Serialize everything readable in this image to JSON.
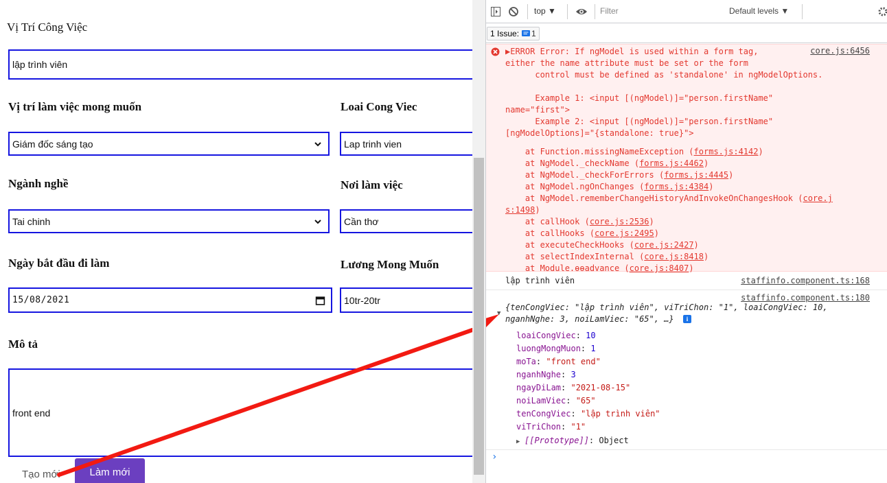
{
  "form": {
    "job_title_label": "Vị Trí Công Việc",
    "job_title_value": "lập trình viên",
    "desired_position_label": "Vị trí làm việc mong muốn",
    "desired_position_value": "Giám đốc sáng tạo",
    "job_type_label": "Loai Cong Viec",
    "job_type_value": "Lap trinh vien",
    "industry_label": "Ngành nghề",
    "industry_value": "Tai chinh",
    "workplace_label": "Nơi làm việc",
    "workplace_value": "Cần thơ",
    "start_date_label": "Ngày bắt đầu đi làm",
    "start_date_value": "15/08/2021",
    "salary_label": "Lương Mong Muốn",
    "salary_value": "10tr-20tr",
    "description_label": "Mô tả",
    "description_value": "front end",
    "create_button": "Tạo mới",
    "reset_button": "Làm mới",
    "primary_color": "#6b3fc0",
    "field_border_color": "#1515e0"
  },
  "devtools": {
    "context": "top ▼",
    "filter_placeholder": "Filter",
    "levels": "Default levels ▼",
    "issues_label": "1 Issue:",
    "issues_count": "1",
    "error_lines": [
      "▶ERROR Error: If ngModel is used within a form tag,",
      "either the name attribute must be set or the form",
      "      control must be defined as 'standalone' in ngModelOptions.",
      "",
      "      Example 1: <input [(ngModel)]=\"person.firstName\"",
      "name=\"first\">",
      "      Example 2: <input [(ngModel)]=\"person.firstName\"",
      "[ngModelOptions]=\"{standalone: true}\">"
    ],
    "error_source": "core.js:6456",
    "stack": [
      {
        "text": "    at Function.missingNameException (",
        "link": "forms.js:4142",
        "tail": ")"
      },
      {
        "text": "    at NgModel._checkName (",
        "link": "forms.js:4462",
        "tail": ")"
      },
      {
        "text": "    at NgModel._checkForErrors (",
        "link": "forms.js:4445",
        "tail": ")"
      },
      {
        "text": "    at NgModel.ngOnChanges (",
        "link": "forms.js:4384",
        "tail": ")"
      },
      {
        "text": "    at NgModel.rememberChangeHistoryAndInvokeOnChangesHook (",
        "link": "core.j",
        "tail": ""
      },
      {
        "text": "",
        "link": "s:1498",
        "tail": ")"
      },
      {
        "text": "    at callHook (",
        "link": "core.js:2536",
        "tail": ")"
      },
      {
        "text": "    at callHooks (",
        "link": "core.js:2495",
        "tail": ")"
      },
      {
        "text": "    at executeCheckHooks (",
        "link": "core.js:2427",
        "tail": ")"
      },
      {
        "text": "    at selectIndexInternal (",
        "link": "core.js:8418",
        "tail": ")"
      },
      {
        "text": "    at Module.ɵɵadvance (",
        "link": "core.js:8407",
        "tail": ")"
      }
    ],
    "log1_text": "lập trình viên",
    "log1_source": "staffinfo.component.ts:168",
    "log2_source": "staffinfo.component.ts:180",
    "obj_summary_1": "{tenCongViec: \"lập trình viên\", viTriChon: \"1\", loaiCongViec: 10,",
    "obj_summary_2": "nganhNghe: 3, noiLamViec: \"65\", …}",
    "props": [
      {
        "key": "loaiCongViec",
        "value": "10",
        "kind": "num"
      },
      {
        "key": "luongMongMuon",
        "value": "1",
        "kind": "num"
      },
      {
        "key": "moTa",
        "value": "\"front end\"",
        "kind": "str"
      },
      {
        "key": "nganhNghe",
        "value": "3",
        "kind": "num"
      },
      {
        "key": "ngayDiLam",
        "value": "\"2021-08-15\"",
        "kind": "str"
      },
      {
        "key": "noiLamViec",
        "value": "\"65\"",
        "kind": "str"
      },
      {
        "key": "tenCongViec",
        "value": "\"lập trình viên\"",
        "kind": "str"
      },
      {
        "key": "viTriChon",
        "value": "\"1\"",
        "kind": "str"
      }
    ],
    "prototype_key": "[[Prototype]]",
    "prototype_value": "Object",
    "prompt": "›"
  }
}
